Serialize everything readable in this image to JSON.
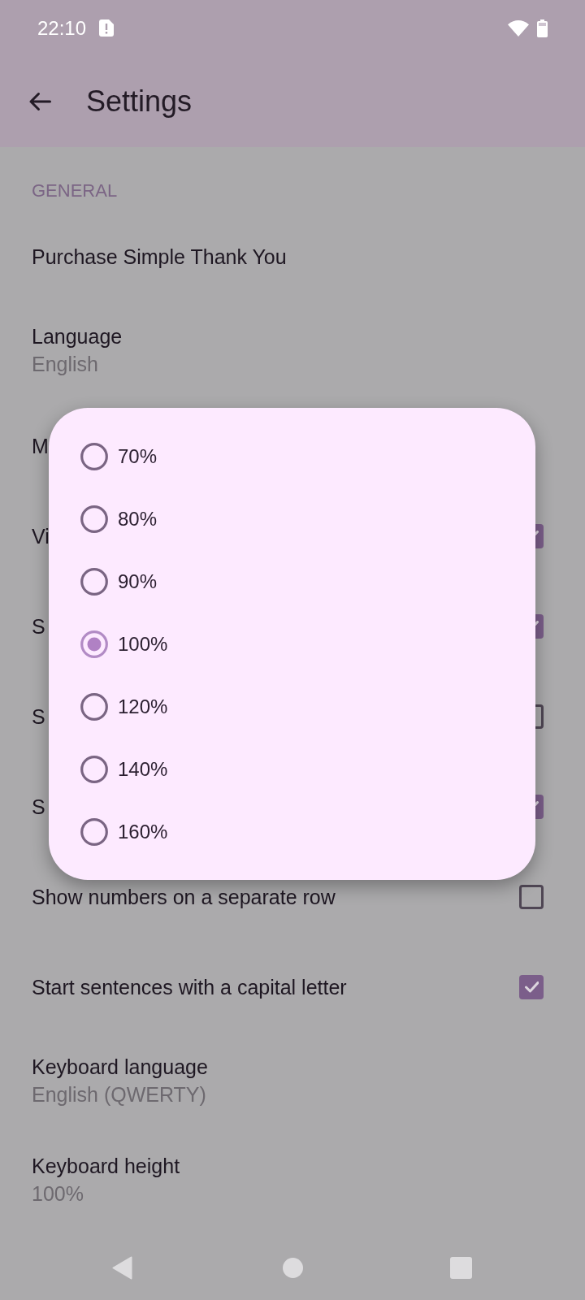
{
  "status_bar": {
    "time": "22:10"
  },
  "app_bar": {
    "title": "Settings"
  },
  "settings": {
    "section": "GENERAL",
    "items": [
      {
        "kind": "plain",
        "title": "Purchase Simple Thank You"
      },
      {
        "kind": "value",
        "title": "Language",
        "value": "English"
      },
      {
        "kind": "plain",
        "title": "M"
      },
      {
        "kind": "checkbox",
        "title": "Vi",
        "checked": true
      },
      {
        "kind": "checkbox",
        "title": "S",
        "checked": true
      },
      {
        "kind": "checkbox",
        "title": "S",
        "checked": false
      },
      {
        "kind": "checkbox",
        "title": "S",
        "checked": true
      },
      {
        "kind": "checkbox",
        "title": "Show numbers on a separate row",
        "checked": false
      },
      {
        "kind": "checkbox",
        "title": "Start sentences with a capital letter",
        "checked": true
      },
      {
        "kind": "value",
        "title": "Keyboard language",
        "value": "English (QWERTY)"
      },
      {
        "kind": "value",
        "title": "Keyboard height",
        "value": "100%"
      }
    ]
  },
  "dialog": {
    "options": [
      {
        "label": "70%",
        "selected": false
      },
      {
        "label": "80%",
        "selected": false
      },
      {
        "label": "90%",
        "selected": false
      },
      {
        "label": "100%",
        "selected": true
      },
      {
        "label": "120%",
        "selected": false
      },
      {
        "label": "140%",
        "selected": false
      },
      {
        "label": "160%",
        "selected": false
      }
    ]
  }
}
